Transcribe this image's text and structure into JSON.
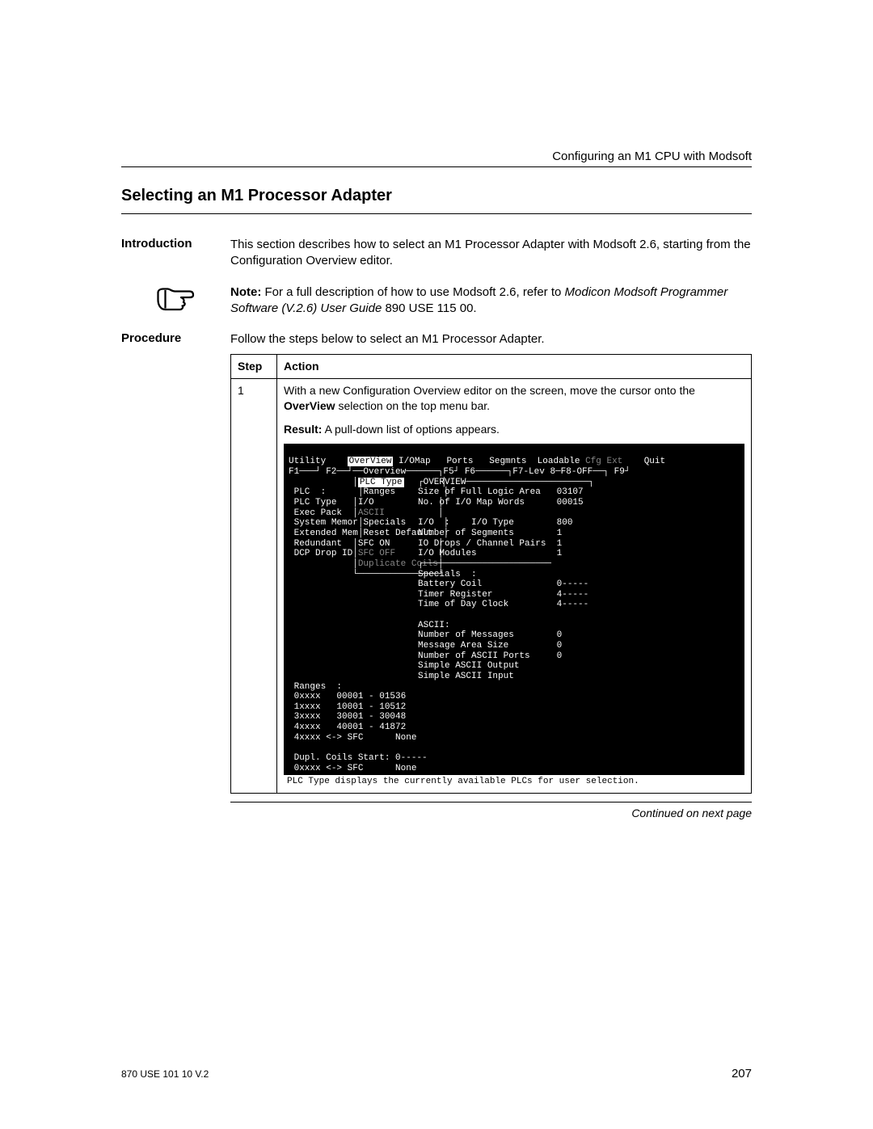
{
  "header": {
    "running": "Configuring an M1 CPU with Modsoft"
  },
  "title": "Selecting an M1 Processor Adapter",
  "intro": {
    "label": "Introduction",
    "text": "This section describes how to select an M1 Processor Adapter with Modsoft 2.6, starting from the Configuration Overview editor."
  },
  "note": {
    "prefix": "Note:",
    "text1": "For a full description of how to use Modsoft 2.6, refer to ",
    "emph1": "Modicon Modsoft Programmer Software (V.2.6) User Guide",
    "text2": " 890 USE 115 00."
  },
  "procedure": {
    "label": "Procedure",
    "text": "Follow the steps below to select an M1 Processor Adapter."
  },
  "table": {
    "headers": {
      "step": "Step",
      "action": "Action"
    },
    "row1": {
      "step": "1",
      "action_pre": "With a new Configuration Overview editor on the screen, move the cursor onto the ",
      "action_bold": "OverView",
      "action_post": " selection on the top menu bar.",
      "result_bold": "Result:",
      "result_text": " A pull-down list of options appears."
    }
  },
  "terminal": {
    "topbar": "Utility    OverView I/OMap   Ports   Segmnts  Loadable Cfg Ext    Quit",
    "fkeys": "F1───┘ F2──┘──Overview──────┐F5┘ F6──────┐F7-Lev 8─F8-OFF──┐ F9┘",
    "menu": {
      "m1": "PLC Type",
      "m2": "Ranges",
      "m3": "I/O",
      "m4_gray": "ASCII",
      "m5": "Specials",
      "m6": "Reset Default",
      "m7": "SFC ON",
      "m8_gray": "SFC OFF",
      "m9_gray": "Duplicate Coils"
    },
    "left": {
      "plc": "PLC  :",
      "plctype": "PLC Type",
      "execpack": "Exec Pack",
      "sysmem": "System Memor",
      "extmem": "Extended Mem",
      "redundant": "Redundant",
      "dcp": "DCP Drop ID",
      "ranges": "Ranges  :",
      "r0": "0xxxx   00001 - 01536",
      "r1": "1xxxx   10001 - 10512",
      "r3": "3xxxx   30001 - 30048",
      "r4": "4xxxx   40001 - 41872",
      "r4s": "4xxxx <-> SFC      None",
      "dupl": "Dupl. Coils Start: 0-----",
      "dup0": "0xxxx <-> SFC      None"
    },
    "right": {
      "ovtitle": "OVERVIEW",
      "logic": "Size of Full Logic Area   03107",
      "mapw": "No. of I/O Map Words      00015",
      "io": "I/O  :    I/O Type        800",
      "segs": "Number of Segments        1",
      "drops": "IO Drops / Channel Pairs  1",
      "mods": "I/O Modules               1",
      "specials": "Specials  :",
      "batt": "Battery Coil              0-----",
      "timer": "Timer Register            4-----",
      "tod": "Time of Day Clock         4-----",
      "ascii": "ASCII:",
      "nmsg": "Number of Messages        0",
      "msgsz": "Message Area Size         0",
      "naports": "Number of ASCII Ports     0",
      "sout": "Simple ASCII Output",
      "sin": "Simple ASCII Input"
    },
    "status": "PLC Type displays the currently available PLCs for user selection."
  },
  "continued": "Continued on next page",
  "footer": {
    "doc": "870 USE 101 10 V.2",
    "page": "207"
  }
}
